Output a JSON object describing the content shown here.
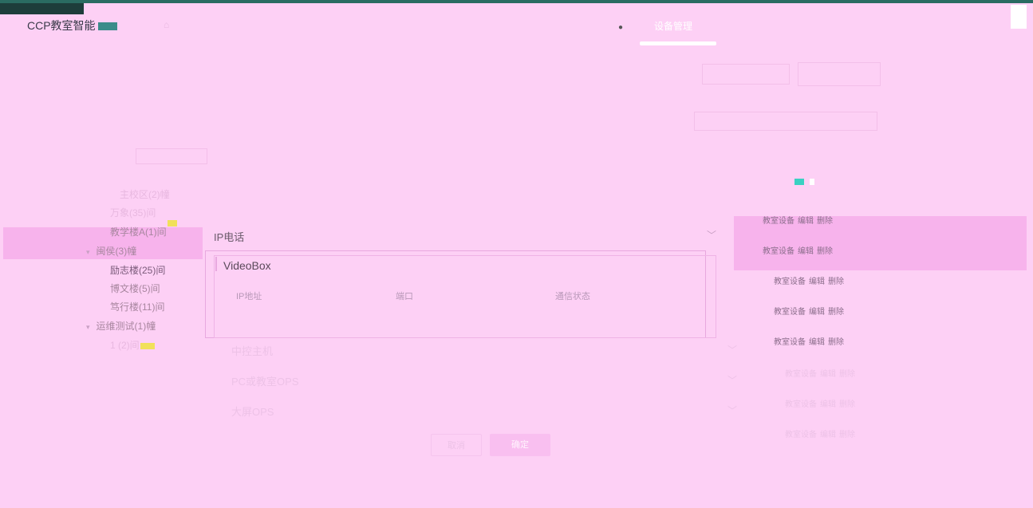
{
  "header": {
    "app_title": "CCP教室智能",
    "nav_tab": "设备管理"
  },
  "tree": [
    {
      "label": "主校区(2)幢",
      "level": 1,
      "style": "dim"
    },
    {
      "label": "万象(35)间",
      "level": 2,
      "style": "dim"
    },
    {
      "label": "教学楼A(1)间",
      "level": 2,
      "style": "normal"
    },
    {
      "label": "闽侯(3)幢",
      "level": 1,
      "style": "normal",
      "caret": "▾"
    },
    {
      "label": "励志楼(25)间",
      "level": 2,
      "style": "selected"
    },
    {
      "label": "博文楼(5)间",
      "level": 2,
      "style": "normal"
    },
    {
      "label": "笃行楼(11)间",
      "level": 2,
      "style": "normal"
    },
    {
      "label": "运维测试(1)幢",
      "level": 1,
      "style": "normal",
      "caret": "▾"
    },
    {
      "label": "1 (2)间",
      "level": 2,
      "style": "dim"
    }
  ],
  "table_rows": [
    {
      "actions": [
        "教室设备",
        "编辑",
        "删除"
      ],
      "style": "normal"
    },
    {
      "actions": [
        "教室设备",
        "编辑",
        "删除"
      ],
      "style": "normal"
    },
    {
      "actions": [
        "教室设备",
        "编辑",
        "删除"
      ],
      "style": "normal"
    },
    {
      "actions": [
        "教室设备",
        "编辑",
        "删除"
      ],
      "style": "normal"
    },
    {
      "actions": [
        "教室设备",
        "编辑",
        "删除"
      ],
      "style": "normal"
    },
    {
      "actions": [
        "教室设备",
        "编辑",
        "删除"
      ],
      "style": "dim"
    },
    {
      "actions": [
        "教室设备",
        "编辑",
        "删除"
      ],
      "style": "dim"
    },
    {
      "actions": [
        "教室设备",
        "编辑",
        "删除"
      ],
      "style": "dim"
    }
  ],
  "modal": {
    "sections": [
      {
        "label": "IP电话",
        "style": "normal"
      },
      {
        "label": "中控主机",
        "style": "dim"
      },
      {
        "label": "PC或教室OPS",
        "style": "dim"
      },
      {
        "label": "大屏OPS",
        "style": "dim"
      }
    ],
    "videobox": {
      "title": "VideoBox",
      "columns": [
        "IP地址",
        "端口",
        "通信状态"
      ]
    },
    "cancel_label": "取消",
    "confirm_label": "确定"
  },
  "colors": {
    "background": "#fdd0f5",
    "accent_dark": "#2a6b62",
    "selected_band": "#f7b3ec"
  }
}
